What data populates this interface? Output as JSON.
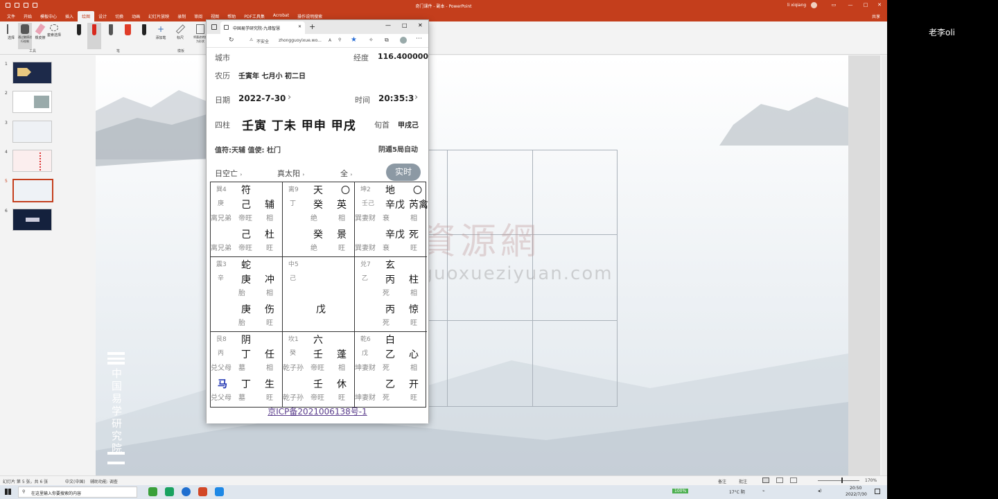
{
  "ppt": {
    "doc_title": "奇门课件 - 副本  -  PowerPoint",
    "user": "li xiqiang",
    "user_initials": "LQ",
    "share": "共享",
    "menu": [
      "文件",
      "开始",
      "模板中心",
      "插入",
      "绘图",
      "设计",
      "切换",
      "动画",
      "幻灯片放映",
      "录制",
      "审阅",
      "视图",
      "帮助",
      "PDF工具集",
      "Acrobat",
      "操作说明搜索"
    ],
    "active_menu": "绘图",
    "ribbon": {
      "select": "选择",
      "draw_touch": "通过触摸进行绘制",
      "eraser": "橡皮擦",
      "lasso": "套索选择",
      "add_pen": "添加笔",
      "ruler": "标尺",
      "ink_to_shape": "将墨迹转换为形状",
      "group_tools": "工具",
      "group_pens": "笔",
      "group_stencils": "模板"
    },
    "slide_numbers": [
      "1",
      "2",
      "3",
      "4",
      "5",
      "6"
    ],
    "status": {
      "slide_info": "幻灯片 第 5 张，共 6 张",
      "language": "中文(中国)",
      "accessibility": "辅助功能: 调查",
      "notes": "备注",
      "comments": "批注",
      "zoom": "170%"
    }
  },
  "taskbar": {
    "search_placeholder": "在这里输入你要搜索的内容",
    "battery": "100%",
    "weather": "17°C 阴",
    "time": "20:50",
    "date": "2022/7/30"
  },
  "presenter_name": "老李oli",
  "browser": {
    "tab_title": "中国易学研究院-九缘智慧",
    "security": "不安全",
    "url": "zhongguoyixue.wo..."
  },
  "qimen": {
    "city_label": "城市",
    "longitude_label": "经度",
    "longitude": "116.400000",
    "lunar_label": "农历",
    "lunar": "壬寅年 七月小 初二日",
    "date_label": "日期",
    "date": "2022-7-30",
    "time_label": "时间",
    "time": "20:35:3",
    "pillars_label": "四柱",
    "pillars": "壬寅 丁未 甲申 甲戌",
    "xunshou_label": "旬首",
    "xunshou": "甲戌己",
    "zhifu": "值符:天辅 值使: 杜门",
    "ju": "阴遁5局自动",
    "opt1": "日空亡",
    "opt2": "真太阳",
    "opt3": "全",
    "live_btn": "实时",
    "footer": "京ICP备2021006138号-1",
    "cells": [
      {
        "gong": "巽4",
        "stem": "庚",
        "rel1": "离兄弟",
        "rel2": "离兄弟",
        "god": "符",
        "s1": "己",
        "star": "辅",
        "st1": "帝旺",
        "st2": "相",
        "s2": "己",
        "door": "杜",
        "dt1": "帝旺",
        "dt2": "旺",
        "extra": ""
      },
      {
        "gong": "离9",
        "stem": "丁",
        "rel1": "",
        "rel2": "",
        "god": "天",
        "s1": "癸",
        "star": "英",
        "st1": "绝",
        "st2": "相",
        "s2": "癸",
        "door": "景",
        "dt1": "绝",
        "dt2": "旺",
        "extra": "〇"
      },
      {
        "gong": "坤2",
        "stem": "壬己",
        "rel1": "巽妻财",
        "rel2": "巽妻财",
        "god": "地",
        "s1": "辛戊",
        "star": "芮禽",
        "st1": "衰",
        "st2": "相",
        "s2": "辛戊",
        "door": "死",
        "dt1": "衰",
        "dt2": "旺",
        "extra": "〇"
      },
      {
        "gong": "震3",
        "stem": "辛",
        "rel1": "",
        "rel2": "",
        "god": "蛇",
        "s1": "庚",
        "star": "冲",
        "st1": "胎",
        "st2": "相",
        "s2": "庚",
        "door": "伤",
        "dt1": "胎",
        "dt2": "旺",
        "extra": ""
      },
      {
        "gong": "中5",
        "stem": "己",
        "rel1": "",
        "rel2": "",
        "god": "",
        "s1": "",
        "star": "",
        "st1": "",
        "st2": "",
        "s2": "戊",
        "door": "",
        "dt1": "",
        "dt2": "",
        "extra": ""
      },
      {
        "gong": "兑7",
        "stem": "乙",
        "rel1": "",
        "rel2": "",
        "god": "玄",
        "s1": "丙",
        "star": "柱",
        "st1": "死",
        "st2": "相",
        "s2": "丙",
        "door": "惊",
        "dt1": "死",
        "dt2": "旺",
        "extra": ""
      },
      {
        "gong": "艮8",
        "stem": "丙",
        "rel1": "兑父母",
        "rel2": "兑父母",
        "god": "阴",
        "s1": "丁",
        "star": "任",
        "st1": "墓",
        "st2": "相",
        "s2": "丁",
        "door": "生",
        "dt1": "墓",
        "dt2": "旺",
        "extra": "马"
      },
      {
        "gong": "坎1",
        "stem": "癸",
        "rel1": "乾子孙",
        "rel2": "乾子孙",
        "god": "六",
        "s1": "壬",
        "star": "蓬",
        "st1": "帝旺",
        "st2": "相",
        "s2": "壬",
        "door": "休",
        "dt1": "帝旺",
        "dt2": "旺",
        "extra": ""
      },
      {
        "gong": "乾6",
        "stem": "戊",
        "rel1": "坤妻财",
        "rel2": "坤妻财",
        "god": "白",
        "s1": "乙",
        "star": "心",
        "st1": "死",
        "st2": "相",
        "s2": "乙",
        "door": "开",
        "dt1": "死",
        "dt2": "旺",
        "extra": ""
      }
    ]
  },
  "slide": {
    "watermark": "國學資源網",
    "watermark_url": "www.guoxueziyuan.com",
    "vertical_title": "中国易学研究院"
  }
}
